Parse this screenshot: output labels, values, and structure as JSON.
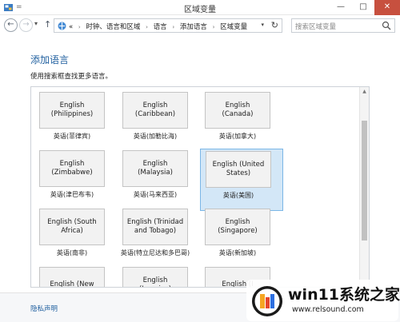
{
  "window": {
    "title": "区域变量"
  },
  "titlebar": {
    "minimize": "—",
    "maximize": "□",
    "close": "✕",
    "quick_access": "="
  },
  "nav": {
    "back_glyph": "←",
    "forward_glyph": "→",
    "recent_glyph": "▾",
    "up_glyph": "↑",
    "breadcrumbs": [
      "时钟、语言和区域",
      "语言",
      "添加语言",
      "区域变量"
    ],
    "overflow": "«",
    "separator": "›",
    "refresh_glyph": "↻",
    "dropdown_glyph": "▾",
    "search_placeholder": "搜索区域变量"
  },
  "content": {
    "heading": "添加语言",
    "description": "使用搜索框查找更多语言。",
    "languages": [
      {
        "name": "English\n(Philippines)",
        "label": "英语(菲律宾)",
        "selected": false
      },
      {
        "name": "English\n(Caribbean)",
        "label": "英语(加勒比海)",
        "selected": false
      },
      {
        "name": "English (Canada)",
        "label": "英语(加拿大)",
        "selected": false
      },
      {
        "name": "English\n(Zimbabwe)",
        "label": "英语(津巴布韦)",
        "selected": false
      },
      {
        "name": "English (Malaysia)",
        "label": "英语(马来西亚)",
        "selected": false
      },
      {
        "name": "English (United\nStates)",
        "label": "英语(美国)",
        "selected": true
      },
      {
        "name": "English (South\nAfrica)",
        "label": "英语(南非)",
        "selected": false
      },
      {
        "name": "English (Trinidad\nand Tobago)",
        "label": "英语(特立尼达和多巴哥)",
        "selected": false
      },
      {
        "name": "English\n(Singapore)",
        "label": "英语(新加坡)",
        "selected": false
      },
      {
        "name": "English (New",
        "label": "",
        "selected": false
      },
      {
        "name": "English (Jamaica)",
        "label": "",
        "selected": false
      },
      {
        "name": "English (I",
        "label": "",
        "selected": false
      }
    ]
  },
  "footer": {
    "privacy_link": "隐私声明"
  },
  "watermark": {
    "title": "win11系统之家",
    "url": "www.relsound.com"
  },
  "colors": {
    "accent": "#1f5f9f",
    "close": "#c7503f",
    "selected_bg": "#d3e7f7",
    "selected_border": "#7bb6e6"
  }
}
